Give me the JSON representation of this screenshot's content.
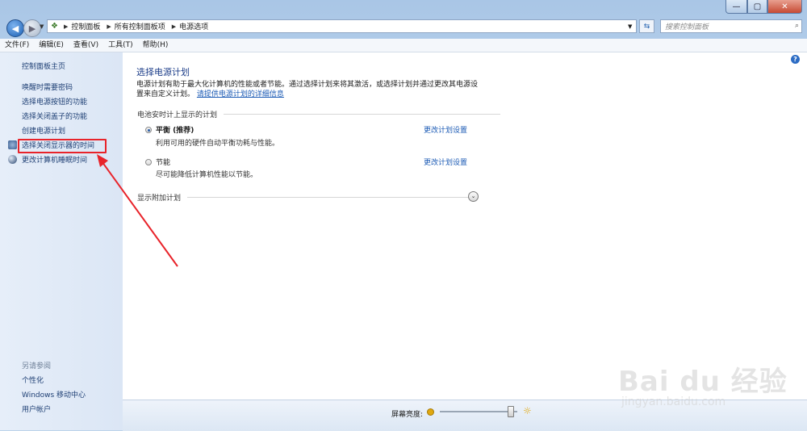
{
  "window": {
    "minimize": "—",
    "maximize": "▢",
    "close": "✕"
  },
  "address": {
    "crumbs": [
      "控制面板",
      "所有控制面板项",
      "电源选项"
    ]
  },
  "search": {
    "placeholder": "搜索控制面板"
  },
  "menu": [
    "文件(F)",
    "编辑(E)",
    "查看(V)",
    "工具(T)",
    "帮助(H)"
  ],
  "sidebar": {
    "home": "控制面板主页",
    "links": [
      "唤醒时需要密码",
      "选择电源按钮的功能",
      "选择关闭盖子的功能",
      "创建电源计划",
      "选择关闭显示器的时间",
      "更改计算机睡眠时间"
    ],
    "see_also": "另请参阅",
    "see_also_links": [
      "个性化",
      "Windows 移动中心",
      "用户帐户"
    ]
  },
  "main": {
    "title": "选择电源计划",
    "desc_text": "电源计划有助于最大化计算机的性能或者节能。通过选择计划来将其激活，或选择计划并通过更改其电源设置来自定义计划。",
    "desc_link": "请提供电源计划的详细信息",
    "group_battery": "电池安时计上显示的计划",
    "plans": [
      {
        "name": "平衡 (推荐)",
        "desc": "利用可用的硬件自动平衡功耗与性能。",
        "selected": true,
        "change": "更改计划设置"
      },
      {
        "name": "节能",
        "desc": "尽可能降低计算机性能以节能。",
        "selected": false,
        "change": "更改计划设置"
      }
    ],
    "group_more": "显示附加计划"
  },
  "brightness": {
    "label": "屏幕亮度:",
    "level": 0.93
  },
  "watermark": {
    "main": "Bai du 经验",
    "url": "jingyan.baidu.com"
  },
  "colors": {
    "accent_link": "#1c5bb5",
    "annotation": "#e8232a"
  }
}
